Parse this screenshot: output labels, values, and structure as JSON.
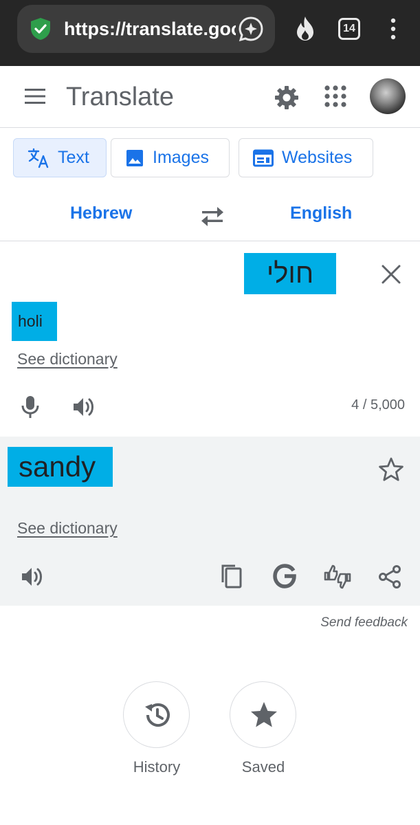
{
  "browser": {
    "url": "https://translate.google.com",
    "tab_count": "14",
    "icons": [
      "shield-check-icon",
      "lens-icon",
      "flame-icon",
      "tabs-icon",
      "more-vert-icon"
    ]
  },
  "header": {
    "title": "Translate",
    "icons": [
      "menu-icon",
      "settings-icon",
      "apps-icon",
      "avatar"
    ]
  },
  "modes": [
    {
      "label": "Text",
      "active": true
    },
    {
      "label": "Images",
      "active": false
    },
    {
      "label": "Websites",
      "active": false
    }
  ],
  "languages": {
    "source": "Hebrew",
    "target": "English"
  },
  "source": {
    "text": "חולי",
    "transliteration": "holi",
    "dictionary_link": "See dictionary",
    "char_count": "4 / 5,000"
  },
  "result": {
    "text": "sandy",
    "dictionary_link": "See dictionary"
  },
  "feedback": "Send feedback",
  "bottom": {
    "history_label": "History",
    "saved_label": "Saved"
  },
  "colors": {
    "accent": "#1a73e8",
    "highlight": "#00aee6",
    "chrome": "#262626",
    "result_bg": "#f1f3f4"
  }
}
